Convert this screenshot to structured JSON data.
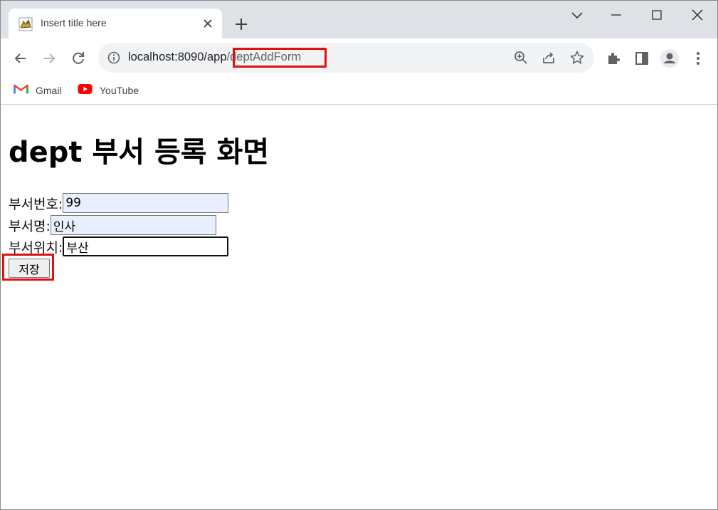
{
  "tab": {
    "title": "Insert title here",
    "favicon": "tomcat-icon"
  },
  "window_controls": [
    "chevron-down-icon",
    "minimize-icon",
    "maximize-icon",
    "close-icon"
  ],
  "omnibox": {
    "host": "localhost:8090/app",
    "path": "/deptAddForm"
  },
  "bookmarks": [
    {
      "label": "Gmail",
      "icon": "gmail-icon"
    },
    {
      "label": "YouTube",
      "icon": "youtube-icon"
    }
  ],
  "page": {
    "heading": "dept 부서 등록 화면",
    "fields": [
      {
        "label": "부서번호:",
        "value": "99"
      },
      {
        "label": "부서명:",
        "value": "인사"
      },
      {
        "label": "부서위치:",
        "value": "부산"
      }
    ],
    "save_label": "저장"
  },
  "colors": {
    "highlight": "#e01010",
    "autofill": "#e8f0fe",
    "tabstrip": "#dee1e6"
  }
}
